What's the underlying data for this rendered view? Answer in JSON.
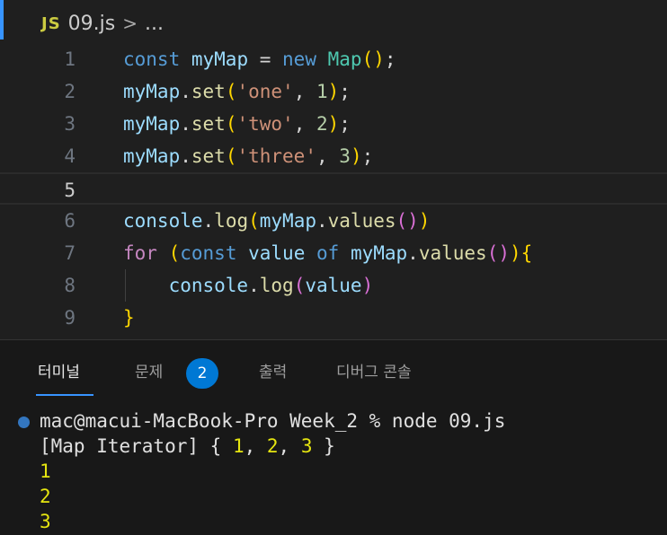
{
  "breadcrumb": {
    "file_badge": "JS",
    "filename": "09.js",
    "separator": ">",
    "more": "..."
  },
  "editor": {
    "current_line": 5,
    "line_numbers": [
      "1",
      "2",
      "3",
      "4",
      "5",
      "6",
      "7",
      "8",
      "9"
    ],
    "lines": [
      [
        [
          "kw",
          "const"
        ],
        [
          "pun",
          " "
        ],
        [
          "var",
          "myMap"
        ],
        [
          "pun",
          " = "
        ],
        [
          "kw",
          "new"
        ],
        [
          "pun",
          " "
        ],
        [
          "cls",
          "Map"
        ],
        [
          "b1",
          "()"
        ],
        [
          "pun",
          ";"
        ]
      ],
      [
        [
          "var",
          "myMap"
        ],
        [
          "pun",
          "."
        ],
        [
          "fn",
          "set"
        ],
        [
          "b1",
          "("
        ],
        [
          "str",
          "'one'"
        ],
        [
          "pun",
          ", "
        ],
        [
          "num",
          "1"
        ],
        [
          "b1",
          ")"
        ],
        [
          "pun",
          ";"
        ]
      ],
      [
        [
          "var",
          "myMap"
        ],
        [
          "pun",
          "."
        ],
        [
          "fn",
          "set"
        ],
        [
          "b1",
          "("
        ],
        [
          "str",
          "'two'"
        ],
        [
          "pun",
          ", "
        ],
        [
          "num",
          "2"
        ],
        [
          "b1",
          ")"
        ],
        [
          "pun",
          ";"
        ]
      ],
      [
        [
          "var",
          "myMap"
        ],
        [
          "pun",
          "."
        ],
        [
          "fn",
          "set"
        ],
        [
          "b1",
          "("
        ],
        [
          "str",
          "'three'"
        ],
        [
          "pun",
          ", "
        ],
        [
          "num",
          "3"
        ],
        [
          "b1",
          ")"
        ],
        [
          "pun",
          ";"
        ]
      ],
      [],
      [
        [
          "var",
          "console"
        ],
        [
          "pun",
          "."
        ],
        [
          "fn",
          "log"
        ],
        [
          "b1",
          "("
        ],
        [
          "var",
          "myMap"
        ],
        [
          "pun",
          "."
        ],
        [
          "fn",
          "values"
        ],
        [
          "b2",
          "()"
        ],
        [
          "b1",
          ")"
        ]
      ],
      [
        [
          "ctl",
          "for"
        ],
        [
          "pun",
          " "
        ],
        [
          "b1",
          "("
        ],
        [
          "kw",
          "const"
        ],
        [
          "pun",
          " "
        ],
        [
          "var",
          "value"
        ],
        [
          "pun",
          " "
        ],
        [
          "kw",
          "of"
        ],
        [
          "pun",
          " "
        ],
        [
          "var",
          "myMap"
        ],
        [
          "pun",
          "."
        ],
        [
          "fn",
          "values"
        ],
        [
          "b2",
          "()"
        ],
        [
          "b1",
          ")"
        ],
        [
          "b1",
          "{"
        ]
      ],
      [
        [
          "pun",
          "    "
        ],
        [
          "var",
          "console"
        ],
        [
          "pun",
          "."
        ],
        [
          "fn",
          "log"
        ],
        [
          "b2",
          "("
        ],
        [
          "var",
          "value"
        ],
        [
          "b2",
          ")"
        ]
      ],
      [
        [
          "b1",
          "}"
        ]
      ]
    ]
  },
  "panel": {
    "tabs": [
      {
        "label": "터미널",
        "active": true
      },
      {
        "label": "문제",
        "active": false
      },
      {
        "label": "출력",
        "active": false
      },
      {
        "label": "디버그 콘솔",
        "active": false
      }
    ],
    "problems_count": "2"
  },
  "terminal": {
    "prompt": "mac@macui-MacBook-Pro Week_2 % node 09.js",
    "output_prefix": "[Map Iterator] { ",
    "output_values": [
      "1",
      "2",
      "3"
    ],
    "output_suffix": " }",
    "output_lines": [
      "1",
      "2",
      "3"
    ]
  },
  "colors": {
    "background": "#1f1f1f",
    "accent": "#3794ff",
    "badge": "#0078d4",
    "terminal_number": "#e5e510"
  }
}
